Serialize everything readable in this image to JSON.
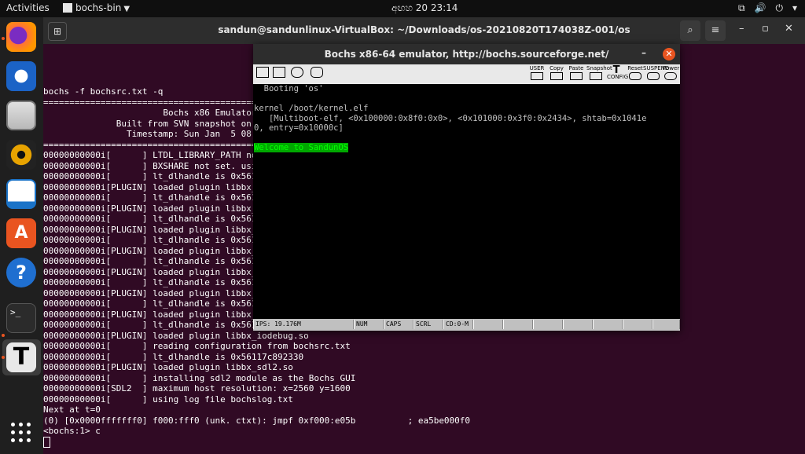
{
  "topbar": {
    "activities": "Activities",
    "app_name": "bochs-bin",
    "clock": "අඟහ 20 23:14",
    "icons": [
      "network-icon",
      "volume-icon",
      "power-icon",
      "chevron-down-icon"
    ]
  },
  "dock": {
    "apps": [
      "firefox",
      "thunderbird",
      "files",
      "rhythmbox",
      "libreoffice-writer",
      "ubuntu-software",
      "help",
      "terminal",
      "bochs"
    ],
    "accent_color": "#e95420"
  },
  "terminal": {
    "title": "sandun@sandunlinux-VirtualBox: ~/Downloads/os-20210820T174038Z-001/os",
    "lines": [
      "bochs -f bochsrc.txt -q",
      "=========================================================================",
      "                       Bochs x86 Emulator 2.7",
      "              Built from SVN snapshot on August 1, 2021",
      "                Timestamp: Sun Jan  5 08:00:00 CET 2021",
      "=========================================================================",
      "00000000000i[      ] LTDL_LIBRARY_PATH not set. using compile time default '/usr/lib/bochs/plugins'",
      "00000000000i[      ] BXSHARE not set. using compile time default '/usr/share/bochs'",
      "00000000000i[      ] lt_dlhandle is 0x56117c88a2b0",
      "00000000000i[PLUGIN] loaded plugin libbx_unmapped.so",
      "00000000000i[      ] lt_dlhandle is 0x56117c88b020",
      "00000000000i[PLUGIN] loaded plugin libbx_biosdev.so",
      "00000000000i[      ] lt_dlhandle is 0x56117c88c9d0",
      "00000000000i[PLUGIN] loaded plugin libbx_speaker.so",
      "00000000000i[      ] lt_dlhandle is 0x56117c88d6f0",
      "00000000000i[PLUGIN] loaded plugin libbx_extfpuirq.so",
      "00000000000i[      ] lt_dlhandle is 0x56117c88e050",
      "00000000000i[PLUGIN] loaded plugin libbx_parallel.so",
      "00000000000i[      ] lt_dlhandle is 0x56117c88fcf0",
      "00000000000i[PLUGIN] loaded plugin libbx_serial.so",
      "00000000000i[      ] lt_dlhandle is 0x56117c893dd0",
      "00000000000i[PLUGIN] loaded plugin libbx_gameport.so",
      "00000000000i[      ] lt_dlhandle is 0x56117c894ae0",
      "00000000000i[PLUGIN] loaded plugin libbx_iodebug.so",
      "00000000000i[      ] reading configuration from bochsrc.txt",
      "00000000000i[      ] lt_dlhandle is 0x56117c892330",
      "00000000000i[PLUGIN] loaded plugin libbx_sdl2.so",
      "00000000000i[      ] installing sdl2 module as the Bochs GUI",
      "00000000000i[SDL2  ] maximum host resolution: x=2560 y=1600",
      "00000000000i[      ] using log file bochslog.txt",
      "Next at t=0",
      "(0) [0x0000fffffff0] f000:fff0 (unk. ctxt): jmpf 0xf000:e05b          ; ea5be000f0",
      "<bochs:1> c"
    ]
  },
  "bochs": {
    "title": "Bochs x86-64 emulator, http://bochs.sourceforge.net/",
    "toolbar_labels": [
      "USER",
      "Copy",
      "Paste",
      "Snapshot",
      "CONFIG",
      "Reset",
      "SUSPEND",
      "Power"
    ],
    "screen_lines": [
      "  Booting 'os'",
      "",
      "kernel /boot/kernel.elf",
      "   [Multiboot-elf, <0x100000:0x8f0:0x0>, <0x101000:0x3f0:0x2434>, shtab=0x1041e",
      "0, entry=0x10000c]",
      ""
    ],
    "welcome": "Welcome to SandunOS",
    "status": {
      "ips": "IPS: 19.176M",
      "num": "NUM",
      "caps": "CAPS",
      "scrl": "SCRL",
      "cd": "CD:0-M"
    }
  }
}
